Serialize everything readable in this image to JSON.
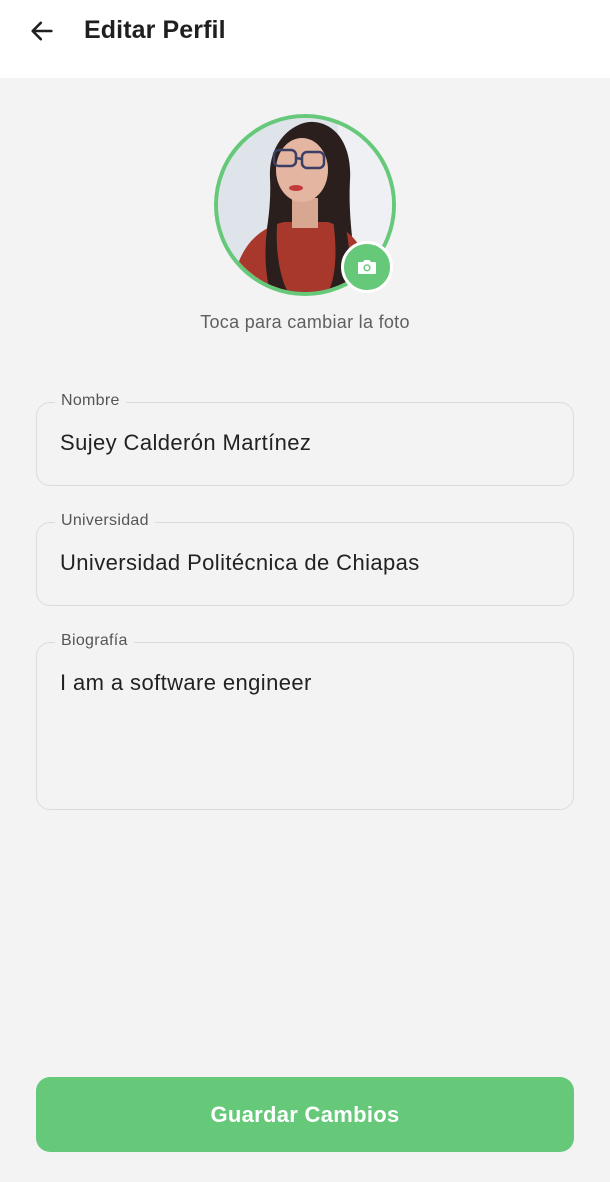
{
  "header": {
    "title": "Editar Perfil",
    "back_icon": "arrow-left-icon"
  },
  "profile": {
    "photo_hint": "Toca para cambiar la foto",
    "camera_icon": "camera-icon"
  },
  "form": {
    "nombre": {
      "label": "Nombre",
      "value": "Sujey Calderón Martínez"
    },
    "universidad": {
      "label": "Universidad",
      "value": "Universidad Politécnica de Chiapas"
    },
    "biografia": {
      "label": "Biografía",
      "value": "I am a software engineer"
    }
  },
  "actions": {
    "save_label": "Guardar Cambios"
  },
  "colors": {
    "accent": "#66c97a",
    "background": "#f3f3f3",
    "appbar": "#ffffff"
  }
}
